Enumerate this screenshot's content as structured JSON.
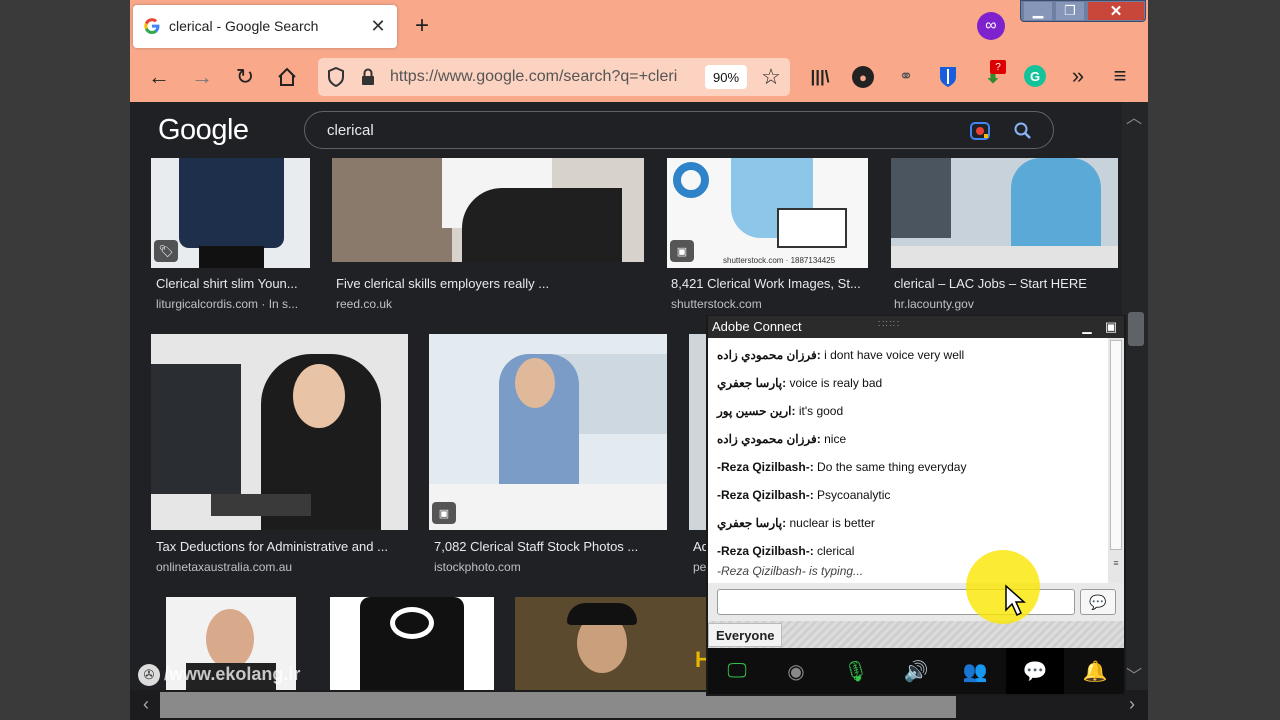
{
  "browser": {
    "tab_title": "clerical - Google Search",
    "url": "https://www.google.com/search?q=+cleri",
    "zoom": "90%",
    "ext_badge": "?"
  },
  "google": {
    "logo": "Google",
    "query": "clerical",
    "row1": [
      {
        "title": "Clerical shirt slim Youn...",
        "source": "liturgicalcordis.com · In s..."
      },
      {
        "title": "Five clerical skills employers really ...",
        "source": "reed.co.uk"
      },
      {
        "title": "8,421 Clerical Work Images, St...",
        "source": "shutterstock.com",
        "watermark": "shutterstock.com · 1887134425"
      },
      {
        "title": "clerical – LAC Jobs – Start HERE",
        "source": "hr.lacounty.gov"
      }
    ],
    "row2": [
      {
        "title": "Tax Deductions for Administrative and ...",
        "source": "onlinetaxaustralia.com.au"
      },
      {
        "title": "7,082 Clerical Staff Stock Photos ...",
        "source": "istockphoto.com"
      },
      {
        "title": "Ad",
        "source": "pe"
      }
    ],
    "partial_letter": "H"
  },
  "watermark": "/www.ekolang.ir",
  "adobe_connect": {
    "title": "Adobe Connect",
    "messages": [
      {
        "name": "فرزان محمودي زاده",
        "text": "i dont have voice very well"
      },
      {
        "name": "پارسا جعفري",
        "text": "voice is realy bad"
      },
      {
        "name": "ارین حسین پور",
        "text": "it's good"
      },
      {
        "name": "فرزان محمودي زاده",
        "text": "nice"
      },
      {
        "name": "-Reza Qizilbash-",
        "text": "Do the same thing everyday"
      },
      {
        "name": "-Reza Qizilbash-",
        "text": "Psycoanalytic"
      },
      {
        "name": "پارسا جعفري",
        "text": "nuclear is better"
      },
      {
        "name": "-Reza Qizilbash-",
        "text": "clerical"
      }
    ],
    "typing": "-Reza Qizilbash- is typing...",
    "input_value": "",
    "audience": "Everyone"
  }
}
